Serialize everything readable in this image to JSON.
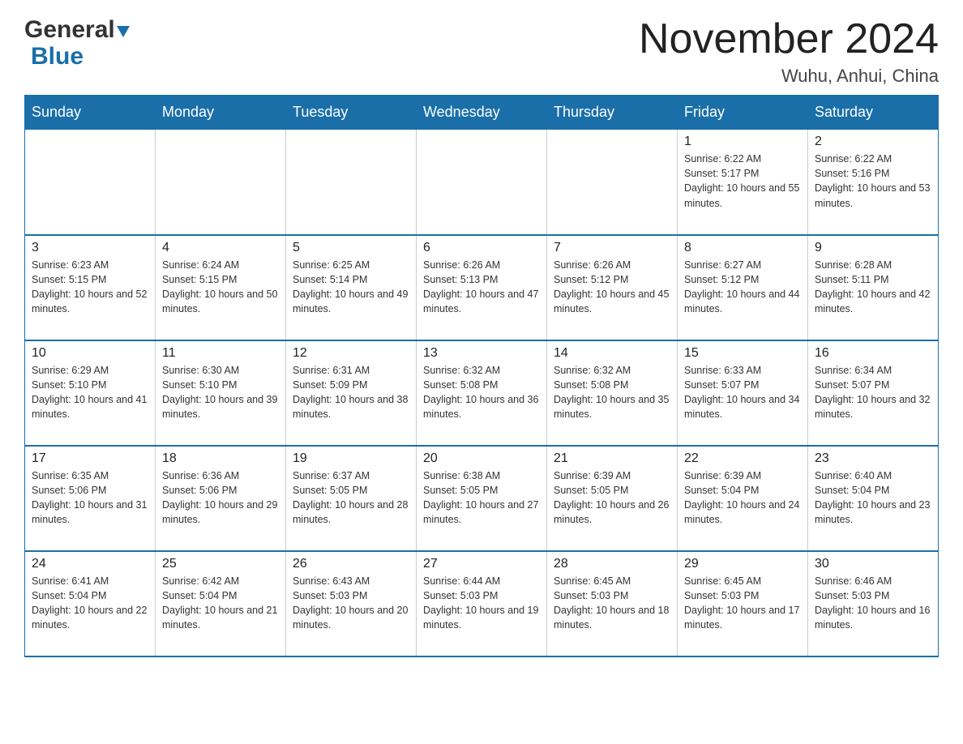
{
  "header": {
    "logo_general": "General",
    "logo_blue": "Blue",
    "month_title": "November 2024",
    "location": "Wuhu, Anhui, China"
  },
  "days_of_week": [
    "Sunday",
    "Monday",
    "Tuesday",
    "Wednesday",
    "Thursday",
    "Friday",
    "Saturday"
  ],
  "weeks": [
    [
      {
        "day": "",
        "info": ""
      },
      {
        "day": "",
        "info": ""
      },
      {
        "day": "",
        "info": ""
      },
      {
        "day": "",
        "info": ""
      },
      {
        "day": "",
        "info": ""
      },
      {
        "day": "1",
        "info": "Sunrise: 6:22 AM\nSunset: 5:17 PM\nDaylight: 10 hours and 55 minutes."
      },
      {
        "day": "2",
        "info": "Sunrise: 6:22 AM\nSunset: 5:16 PM\nDaylight: 10 hours and 53 minutes."
      }
    ],
    [
      {
        "day": "3",
        "info": "Sunrise: 6:23 AM\nSunset: 5:15 PM\nDaylight: 10 hours and 52 minutes."
      },
      {
        "day": "4",
        "info": "Sunrise: 6:24 AM\nSunset: 5:15 PM\nDaylight: 10 hours and 50 minutes."
      },
      {
        "day": "5",
        "info": "Sunrise: 6:25 AM\nSunset: 5:14 PM\nDaylight: 10 hours and 49 minutes."
      },
      {
        "day": "6",
        "info": "Sunrise: 6:26 AM\nSunset: 5:13 PM\nDaylight: 10 hours and 47 minutes."
      },
      {
        "day": "7",
        "info": "Sunrise: 6:26 AM\nSunset: 5:12 PM\nDaylight: 10 hours and 45 minutes."
      },
      {
        "day": "8",
        "info": "Sunrise: 6:27 AM\nSunset: 5:12 PM\nDaylight: 10 hours and 44 minutes."
      },
      {
        "day": "9",
        "info": "Sunrise: 6:28 AM\nSunset: 5:11 PM\nDaylight: 10 hours and 42 minutes."
      }
    ],
    [
      {
        "day": "10",
        "info": "Sunrise: 6:29 AM\nSunset: 5:10 PM\nDaylight: 10 hours and 41 minutes."
      },
      {
        "day": "11",
        "info": "Sunrise: 6:30 AM\nSunset: 5:10 PM\nDaylight: 10 hours and 39 minutes."
      },
      {
        "day": "12",
        "info": "Sunrise: 6:31 AM\nSunset: 5:09 PM\nDaylight: 10 hours and 38 minutes."
      },
      {
        "day": "13",
        "info": "Sunrise: 6:32 AM\nSunset: 5:08 PM\nDaylight: 10 hours and 36 minutes."
      },
      {
        "day": "14",
        "info": "Sunrise: 6:32 AM\nSunset: 5:08 PM\nDaylight: 10 hours and 35 minutes."
      },
      {
        "day": "15",
        "info": "Sunrise: 6:33 AM\nSunset: 5:07 PM\nDaylight: 10 hours and 34 minutes."
      },
      {
        "day": "16",
        "info": "Sunrise: 6:34 AM\nSunset: 5:07 PM\nDaylight: 10 hours and 32 minutes."
      }
    ],
    [
      {
        "day": "17",
        "info": "Sunrise: 6:35 AM\nSunset: 5:06 PM\nDaylight: 10 hours and 31 minutes."
      },
      {
        "day": "18",
        "info": "Sunrise: 6:36 AM\nSunset: 5:06 PM\nDaylight: 10 hours and 29 minutes."
      },
      {
        "day": "19",
        "info": "Sunrise: 6:37 AM\nSunset: 5:05 PM\nDaylight: 10 hours and 28 minutes."
      },
      {
        "day": "20",
        "info": "Sunrise: 6:38 AM\nSunset: 5:05 PM\nDaylight: 10 hours and 27 minutes."
      },
      {
        "day": "21",
        "info": "Sunrise: 6:39 AM\nSunset: 5:05 PM\nDaylight: 10 hours and 26 minutes."
      },
      {
        "day": "22",
        "info": "Sunrise: 6:39 AM\nSunset: 5:04 PM\nDaylight: 10 hours and 24 minutes."
      },
      {
        "day": "23",
        "info": "Sunrise: 6:40 AM\nSunset: 5:04 PM\nDaylight: 10 hours and 23 minutes."
      }
    ],
    [
      {
        "day": "24",
        "info": "Sunrise: 6:41 AM\nSunset: 5:04 PM\nDaylight: 10 hours and 22 minutes."
      },
      {
        "day": "25",
        "info": "Sunrise: 6:42 AM\nSunset: 5:04 PM\nDaylight: 10 hours and 21 minutes."
      },
      {
        "day": "26",
        "info": "Sunrise: 6:43 AM\nSunset: 5:03 PM\nDaylight: 10 hours and 20 minutes."
      },
      {
        "day": "27",
        "info": "Sunrise: 6:44 AM\nSunset: 5:03 PM\nDaylight: 10 hours and 19 minutes."
      },
      {
        "day": "28",
        "info": "Sunrise: 6:45 AM\nSunset: 5:03 PM\nDaylight: 10 hours and 18 minutes."
      },
      {
        "day": "29",
        "info": "Sunrise: 6:45 AM\nSunset: 5:03 PM\nDaylight: 10 hours and 17 minutes."
      },
      {
        "day": "30",
        "info": "Sunrise: 6:46 AM\nSunset: 5:03 PM\nDaylight: 10 hours and 16 minutes."
      }
    ]
  ]
}
